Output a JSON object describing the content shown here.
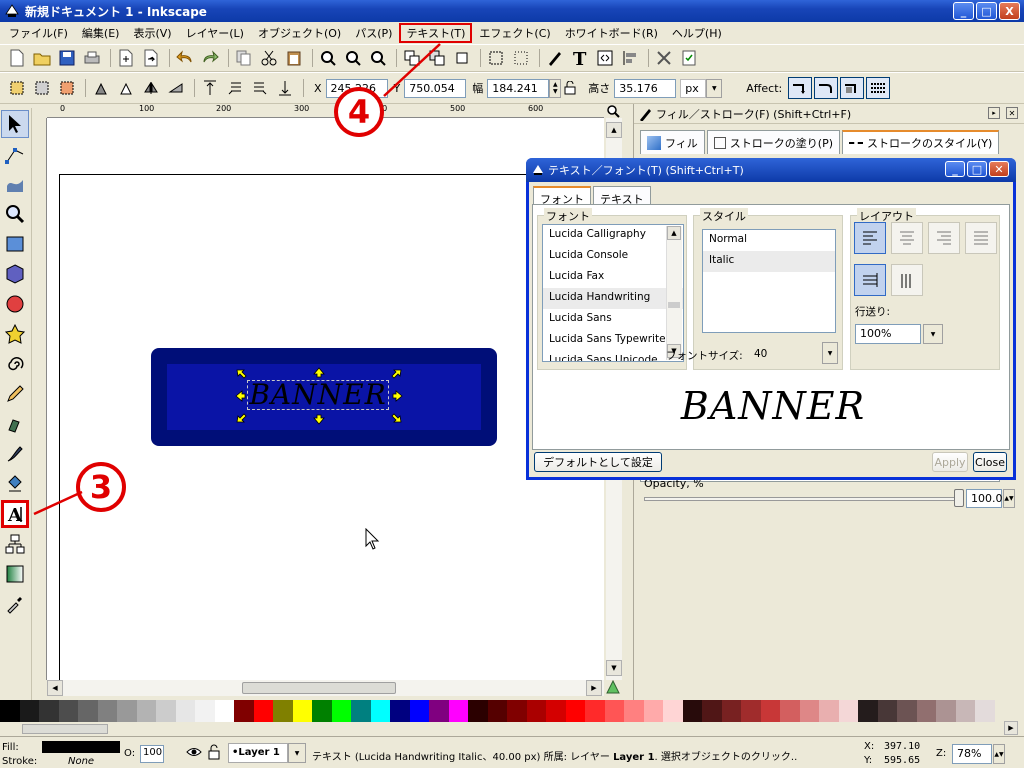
{
  "window": {
    "title": "新規ドキュメント 1 - Inkscape",
    "minimize": "_",
    "maximize": "□",
    "close": "X"
  },
  "menu": [
    "ファイル(F)",
    "編集(E)",
    "表示(V)",
    "レイヤー(L)",
    "オブジェクト(O)",
    "パス(P)",
    "テキスト(T)",
    "エフェクト(C)",
    "ホワイトボード(R)",
    "ヘルプ(H)"
  ],
  "toolbar2": {
    "x_label": "X",
    "x_value": "245.226",
    "y_label": "Y",
    "y_value": "750.054",
    "w_label": "幅",
    "w_value": "184.241",
    "h_label": "高さ",
    "h_value": "35.176",
    "unit": "px",
    "affect_label": "Affect:"
  },
  "ruler_h": [
    "0",
    "100",
    "200",
    "300",
    "400",
    "500",
    "600"
  ],
  "canvas": {
    "banner_text": "BANNER"
  },
  "dock": {
    "title": "フィル／ストローク(F) (Shift+Ctrl+F)",
    "tabs": [
      "フィル",
      "ストロークの塗り(P)",
      "ストロークのスタイル(Y)"
    ],
    "opacity_label": "Opacity, %",
    "opacity_value": "100.0",
    "opacity_level": 1.0
  },
  "text_dialog": {
    "title": "テキスト／フォント(T) (Shift+Ctrl+T)",
    "tabs": [
      "フォント",
      "テキスト"
    ],
    "font_group": "フォント",
    "fonts": [
      "Lucida Calligraphy",
      "Lucida Console",
      "Lucida Fax",
      "Lucida Handwriting",
      "Lucida Sans",
      "Lucida Sans Typewriter",
      "Lucida Sans Unicode"
    ],
    "selected_font": "Lucida Handwriting",
    "style_group": "スタイル",
    "styles": [
      "Normal",
      "Italic"
    ],
    "selected_style": "Italic",
    "font_size_label": "フォントサイズ:",
    "font_size": "40",
    "layout_group": "レイアウト",
    "line_spacing_label": "行送り:",
    "line_spacing": "100%",
    "preview_text": "BANNER",
    "set_default_button": "デフォルトとして設定",
    "apply_button": "Apply",
    "close_button": "Close"
  },
  "status": {
    "fill_label": "Fill:",
    "stroke_label": "Stroke:",
    "stroke_value": "None",
    "opacity_label": "O:",
    "opacity_value": "100",
    "layer": "•Layer 1",
    "message_prefix": "テキスト (Lucida Handwriting Italic、40.00 px) 所属: レイヤー",
    "message_layer": "Layer 1",
    "message_suffix": ". 選択オブジェクトのクリック..",
    "x_label": "X:",
    "x_value": "397.10",
    "y_label": "Y:",
    "y_value": "595.65",
    "zoom_label": "Z:",
    "zoom_value": "78%"
  },
  "annotations": {
    "step3": "3",
    "step4": "4"
  },
  "palette": [
    "#000000",
    "#1a1a1a",
    "#333333",
    "#4d4d4d",
    "#666666",
    "#808080",
    "#999999",
    "#b3b3b3",
    "#cccccc",
    "#e6e6e6",
    "#f2f2f2",
    "#ffffff",
    "#800000",
    "#ff0000",
    "#808000",
    "#ffff00",
    "#008000",
    "#00ff00",
    "#008080",
    "#00ffff",
    "#000080",
    "#0000ff",
    "#800080",
    "#ff00ff",
    "#2b0000",
    "#550000",
    "#800000",
    "#aa0000",
    "#d40000",
    "#ff0000",
    "#ff2a2a",
    "#ff5555",
    "#ff8080",
    "#ffaaaa",
    "#ffd5d5",
    "#280b0b",
    "#501616",
    "#782121",
    "#a02c2c",
    "#c83737",
    "#d35f5f",
    "#de8787",
    "#e9afaf",
    "#f4d7d7",
    "#241c1c",
    "#483737",
    "#6c5353",
    "#916f6f",
    "#ac9393",
    "#c8b7b7",
    "#e3dbdb"
  ]
}
